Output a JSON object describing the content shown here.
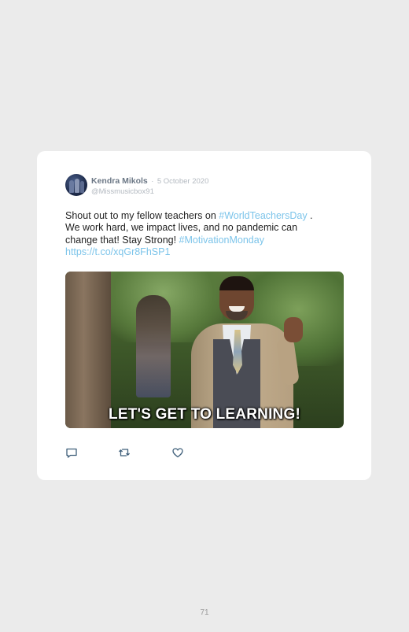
{
  "tweet": {
    "author_name": "Kendra Mikols",
    "separator": "·",
    "date": "5 October 2020",
    "handle": "@Missmusicbox91",
    "text_1": "Shout out to my fellow teachers on ",
    "hashtag_1": "#WorldTeachersDay",
    "text_2": " . We work hard, we impact lives, and no pandemic can change that! Stay Strong! ",
    "hashtag_2": "#MotivationMonday",
    "link": "https://t.co/xqGr8FhSP1",
    "media_caption": "LET'S GET TO LEARNING!"
  },
  "actions": {
    "reply_icon": "reply-icon",
    "retweet_icon": "retweet-icon",
    "like_icon": "heart-icon"
  },
  "page": {
    "number": "71"
  },
  "colors": {
    "background": "#ebebeb",
    "card": "#ffffff",
    "link": "#7cc4ea",
    "name": "#6b7785",
    "muted": "#b3b9c0"
  }
}
